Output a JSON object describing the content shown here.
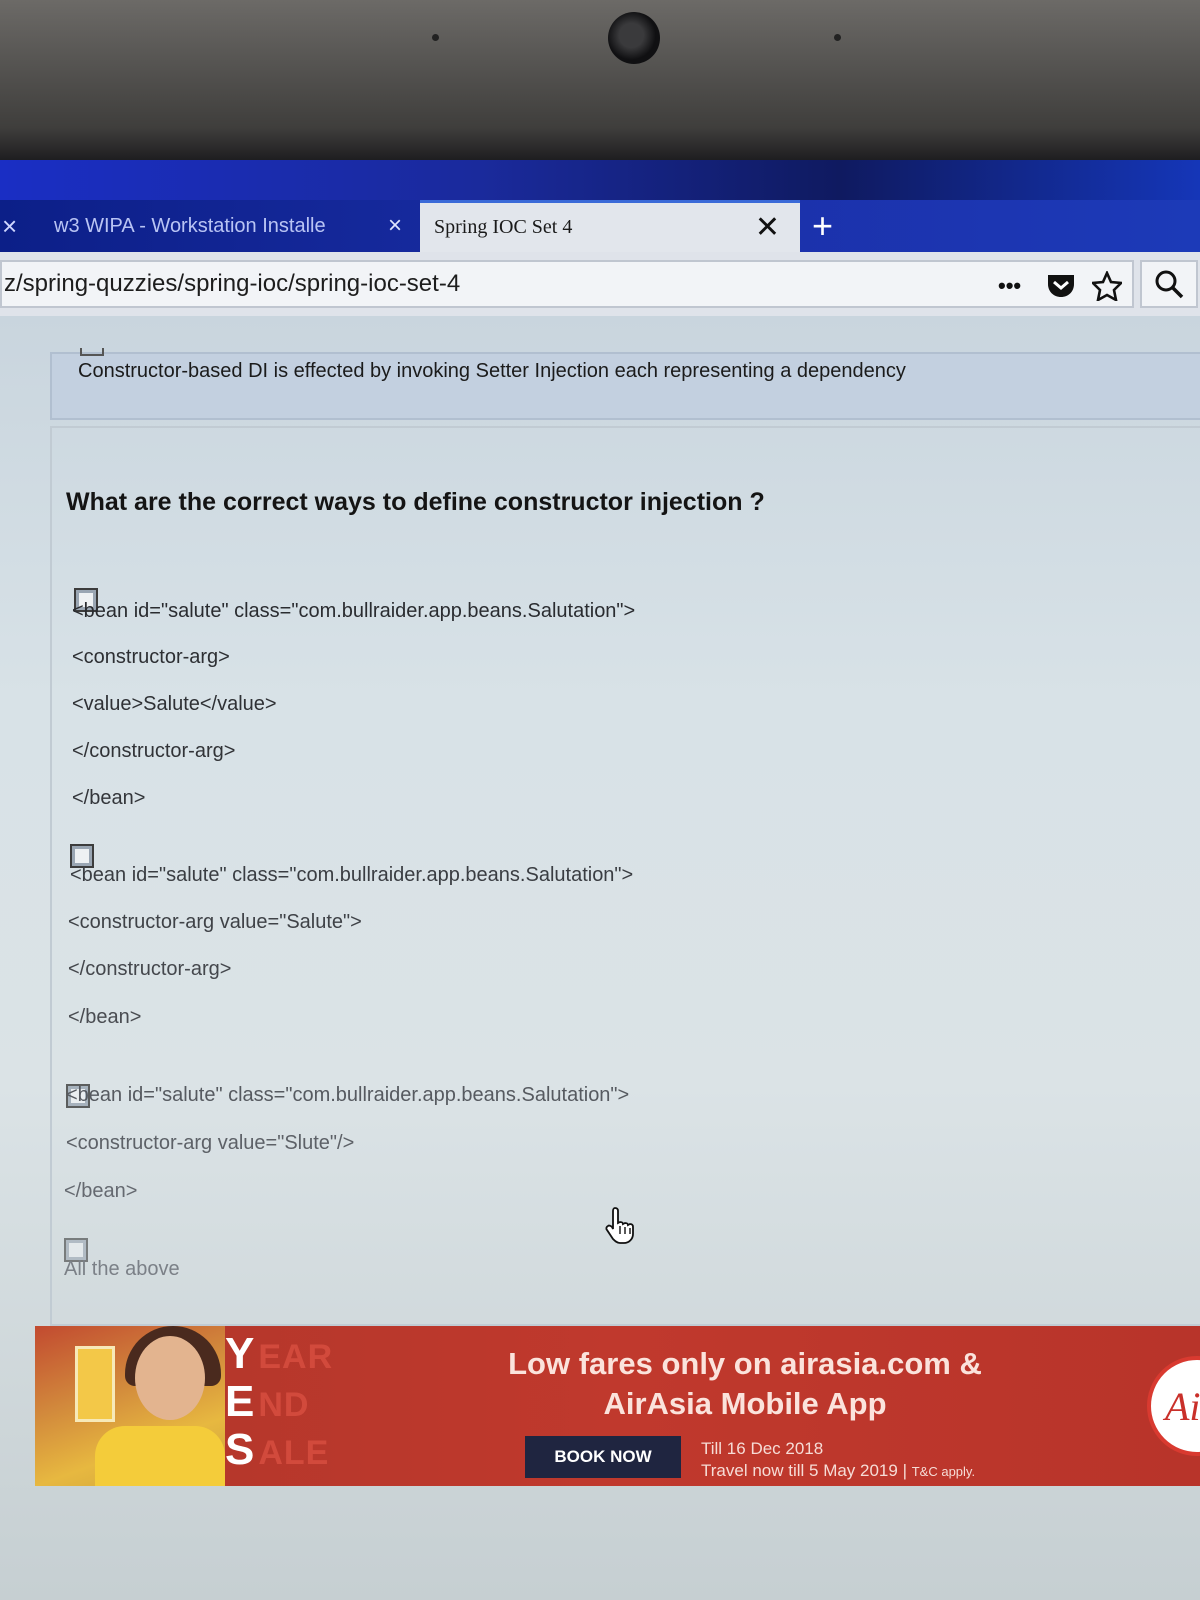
{
  "browser": {
    "tabs": [
      {
        "label": "w3  WIPA - Workstation Installe",
        "favicon": "w3",
        "active": false
      },
      {
        "label": "Spring IOC Set 4",
        "active": true
      }
    ],
    "url": "z/spring-quzzies/spring-ioc/spring-ioc-set-4"
  },
  "previous_question": {
    "option_text": "Constructor-based DI is effected by invoking Setter Injection each representing a dependency"
  },
  "question": {
    "text": "What are the correct ways to define constructor injection ?",
    "options": [
      {
        "checked": false,
        "lines": [
          "<bean id=\"salute\" class=\"com.bullraider.app.beans.Salutation\">",
          "<constructor-arg>",
          "<value>Salute</value>",
          "</constructor-arg>",
          "</bean>"
        ]
      },
      {
        "checked": false,
        "lines": [
          "<bean id=\"salute\" class=\"com.bullraider.app.beans.Salutation\">",
          "<constructor-arg value=\"Salute\">",
          "</constructor-arg>",
          "</bean>"
        ]
      },
      {
        "checked": false,
        "lines": [
          "<bean id=\"salute\" class=\"com.bullraider.app.beans.Salutation\">",
          "<constructor-arg value=\"Slute\"/>",
          "</bean>"
        ]
      },
      {
        "checked": false,
        "lines": [
          "All the above"
        ]
      }
    ]
  },
  "ad": {
    "yes_letters": [
      "Y",
      "E",
      "S"
    ],
    "yes_words": [
      "EAR",
      "ND",
      "ALE"
    ],
    "headline_line1": "Low fares only on airasia.com &",
    "headline_line2": "AirAsia Mobile App",
    "cta": "BOOK NOW",
    "terms_line1": "Till 16 Dec 2018",
    "terms_line2": "Travel now till 5 May 2019",
    "terms_small": "T&C apply.",
    "logo_text": "Ai",
    "brand_color": "#c0392d"
  },
  "icons": [
    "close-icon",
    "plus-icon",
    "more-icon",
    "pocket-icon",
    "star-icon",
    "search-icon",
    "hand-cursor-icon"
  ]
}
